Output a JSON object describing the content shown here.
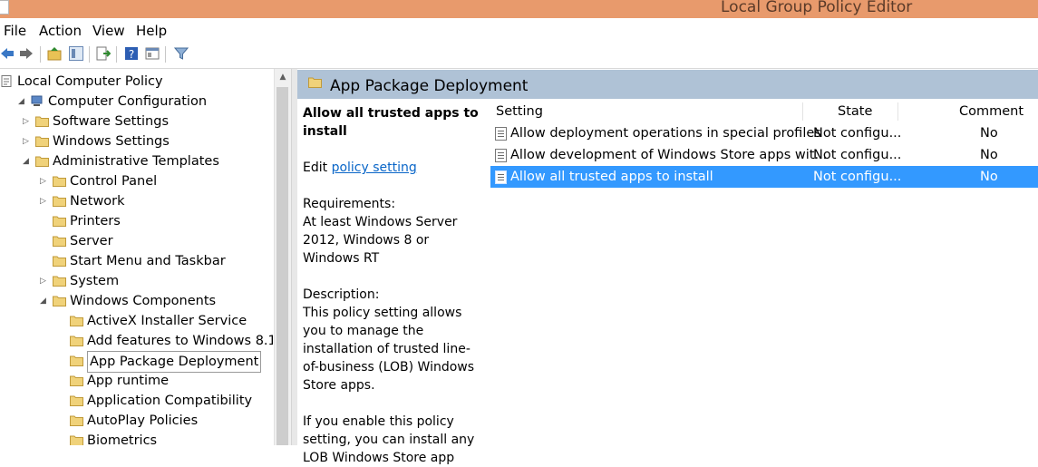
{
  "window": {
    "title": "Local Group Policy Editor"
  },
  "menu": [
    "File",
    "Action",
    "View",
    "Help"
  ],
  "toolbar_icons": [
    "back-arrow-icon",
    "forward-arrow-icon",
    "up-folder-icon",
    "show-hide-tree-icon",
    "export-list-icon",
    "help-icon",
    "properties-icon",
    "filter-icon"
  ],
  "tree": [
    {
      "label": "Local Computer Policy",
      "level": 0,
      "expander": "",
      "icon": "policy-icon"
    },
    {
      "label": "Computer Configuration",
      "level": 1,
      "expander": "open",
      "icon": "computer-icon"
    },
    {
      "label": "Software Settings",
      "level": 2,
      "expander": "closed",
      "icon": "folder-icon"
    },
    {
      "label": "Windows Settings",
      "level": 2,
      "expander": "closed",
      "icon": "folder-icon"
    },
    {
      "label": "Administrative Templates",
      "level": 2,
      "expander": "open",
      "icon": "folder-icon"
    },
    {
      "label": "Control Panel",
      "level": 3,
      "expander": "closed",
      "icon": "folder-icon"
    },
    {
      "label": "Network",
      "level": 3,
      "expander": "closed",
      "icon": "folder-icon"
    },
    {
      "label": "Printers",
      "level": 3,
      "expander": "",
      "icon": "folder-icon"
    },
    {
      "label": "Server",
      "level": 3,
      "expander": "",
      "icon": "folder-icon"
    },
    {
      "label": "Start Menu and Taskbar",
      "level": 3,
      "expander": "",
      "icon": "folder-icon"
    },
    {
      "label": "System",
      "level": 3,
      "expander": "closed",
      "icon": "folder-icon"
    },
    {
      "label": "Windows Components",
      "level": 3,
      "expander": "open",
      "icon": "folder-icon"
    },
    {
      "label": "ActiveX Installer Service",
      "level": 4,
      "expander": "",
      "icon": "folder-icon"
    },
    {
      "label": "Add features to Windows 8.1",
      "level": 4,
      "expander": "",
      "icon": "folder-icon"
    },
    {
      "label": "App Package Deployment",
      "level": 4,
      "expander": "",
      "icon": "folder-icon",
      "selected": true
    },
    {
      "label": "App runtime",
      "level": 4,
      "expander": "",
      "icon": "folder-icon"
    },
    {
      "label": "Application Compatibility",
      "level": 4,
      "expander": "",
      "icon": "folder-icon"
    },
    {
      "label": "AutoPlay Policies",
      "level": 4,
      "expander": "",
      "icon": "folder-icon"
    },
    {
      "label": "Biometrics",
      "level": 4,
      "expander": "",
      "icon": "folder-icon"
    }
  ],
  "right_header": {
    "title": "App Package Deployment"
  },
  "description": {
    "title": "Allow all trusted apps to install",
    "edit_prefix": "Edit ",
    "edit_link": "policy setting ",
    "requirements_label": "Requirements:",
    "requirements_text": "At least Windows Server 2012, Windows 8 or Windows RT",
    "description_label": "Description:",
    "description_text": "This policy setting allows you to manage the installation of trusted line-of-business (LOB) Windows Store apps.",
    "extra_text": "If you enable this policy setting, you can install any LOB Windows Store app"
  },
  "list": {
    "columns": [
      "Setting",
      "State",
      "Comment"
    ],
    "rows": [
      {
        "setting": "Allow deployment operations in special profiles",
        "state": "Not configu...",
        "comment": "No",
        "selected": false
      },
      {
        "setting": "Allow development of Windows Store apps wit...",
        "state": "Not configu...",
        "comment": "No",
        "selected": false
      },
      {
        "setting": "Allow all trusted apps to install",
        "state": "Not configu...",
        "comment": "No",
        "selected": true
      }
    ]
  },
  "colors": {
    "titlebar": "#e89a6c",
    "header": "#afc2d6",
    "selection": "#3399ff",
    "link": "#0a66c8"
  }
}
